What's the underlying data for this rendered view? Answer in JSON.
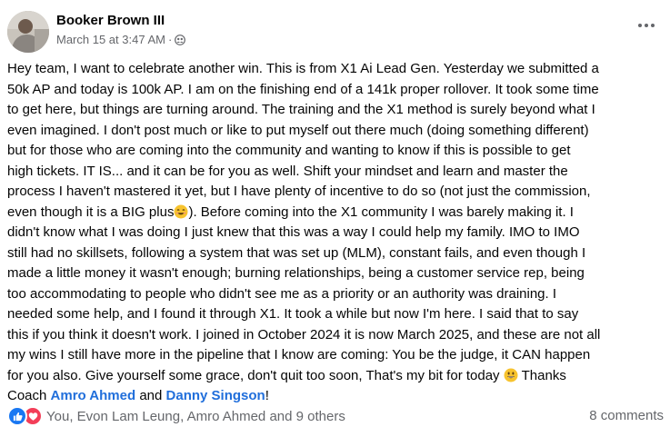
{
  "post": {
    "author": "Booker Brown III",
    "timestamp": "March 15 at 3:47 AM",
    "separator": "·",
    "audience_icon": "group-icon",
    "more_icon": "more-options-icon",
    "lines": [
      "Hey team, I want to celebrate another win. This is from X1 Ai Lead Gen. Yesterday we submitted a",
      "50k AP and today is 100k AP. I am on the finishing end of a 141k proper rollover. It took some time",
      "to get here, but things are turning around. The training and the X1 method is surely beyond what I",
      "even imagined. I don't post much or like to put myself out there much (doing something different)",
      "but for those who are coming into the community and wanting to know if this is possible to get",
      "high tickets. IT IS... and it can be for you as well. Shift your mindset and learn and master the",
      "process I haven't mastered it yet, but I have plenty of incentive to do so (not just the commission,",
      "even though it is a BIG plus",
      "). Before coming into the X1 community I was barely making it. I",
      "didn't know what I was doing I just knew that this was a way I could help my family. IMO to IMO",
      "still had no skillsets, following a system that was set up (MLM), constant fails, and even though I",
      "made a little money it wasn't enough; burning relationships, being a customer service rep, being",
      "too accommodating to people who didn't see me as a priority or an authority was draining. I",
      "needed some help, and I found it through X1. It took a while but now I'm here. I said that to say",
      "this if you think it doesn't work. I joined in October 2024 it is now March 2025, and these are not all",
      "my wins I still have more in the pipeline that I know are coming: You be the judge, it CAN happen",
      "for you also. Give yourself some grace, don't quit too soon, That's my bit for today",
      " Thanks",
      "Coach ",
      "Amro Ahmed",
      " and ",
      "Danny Singson",
      "!"
    ],
    "reactions_text": "You, Evon Lam Leung, Amro Ahmed and 9 others",
    "comments_text": "8 comments",
    "colors": {
      "mention": "#216fdb",
      "like": "#1877f2",
      "love": "#f33e58",
      "meta": "#65676b"
    }
  }
}
